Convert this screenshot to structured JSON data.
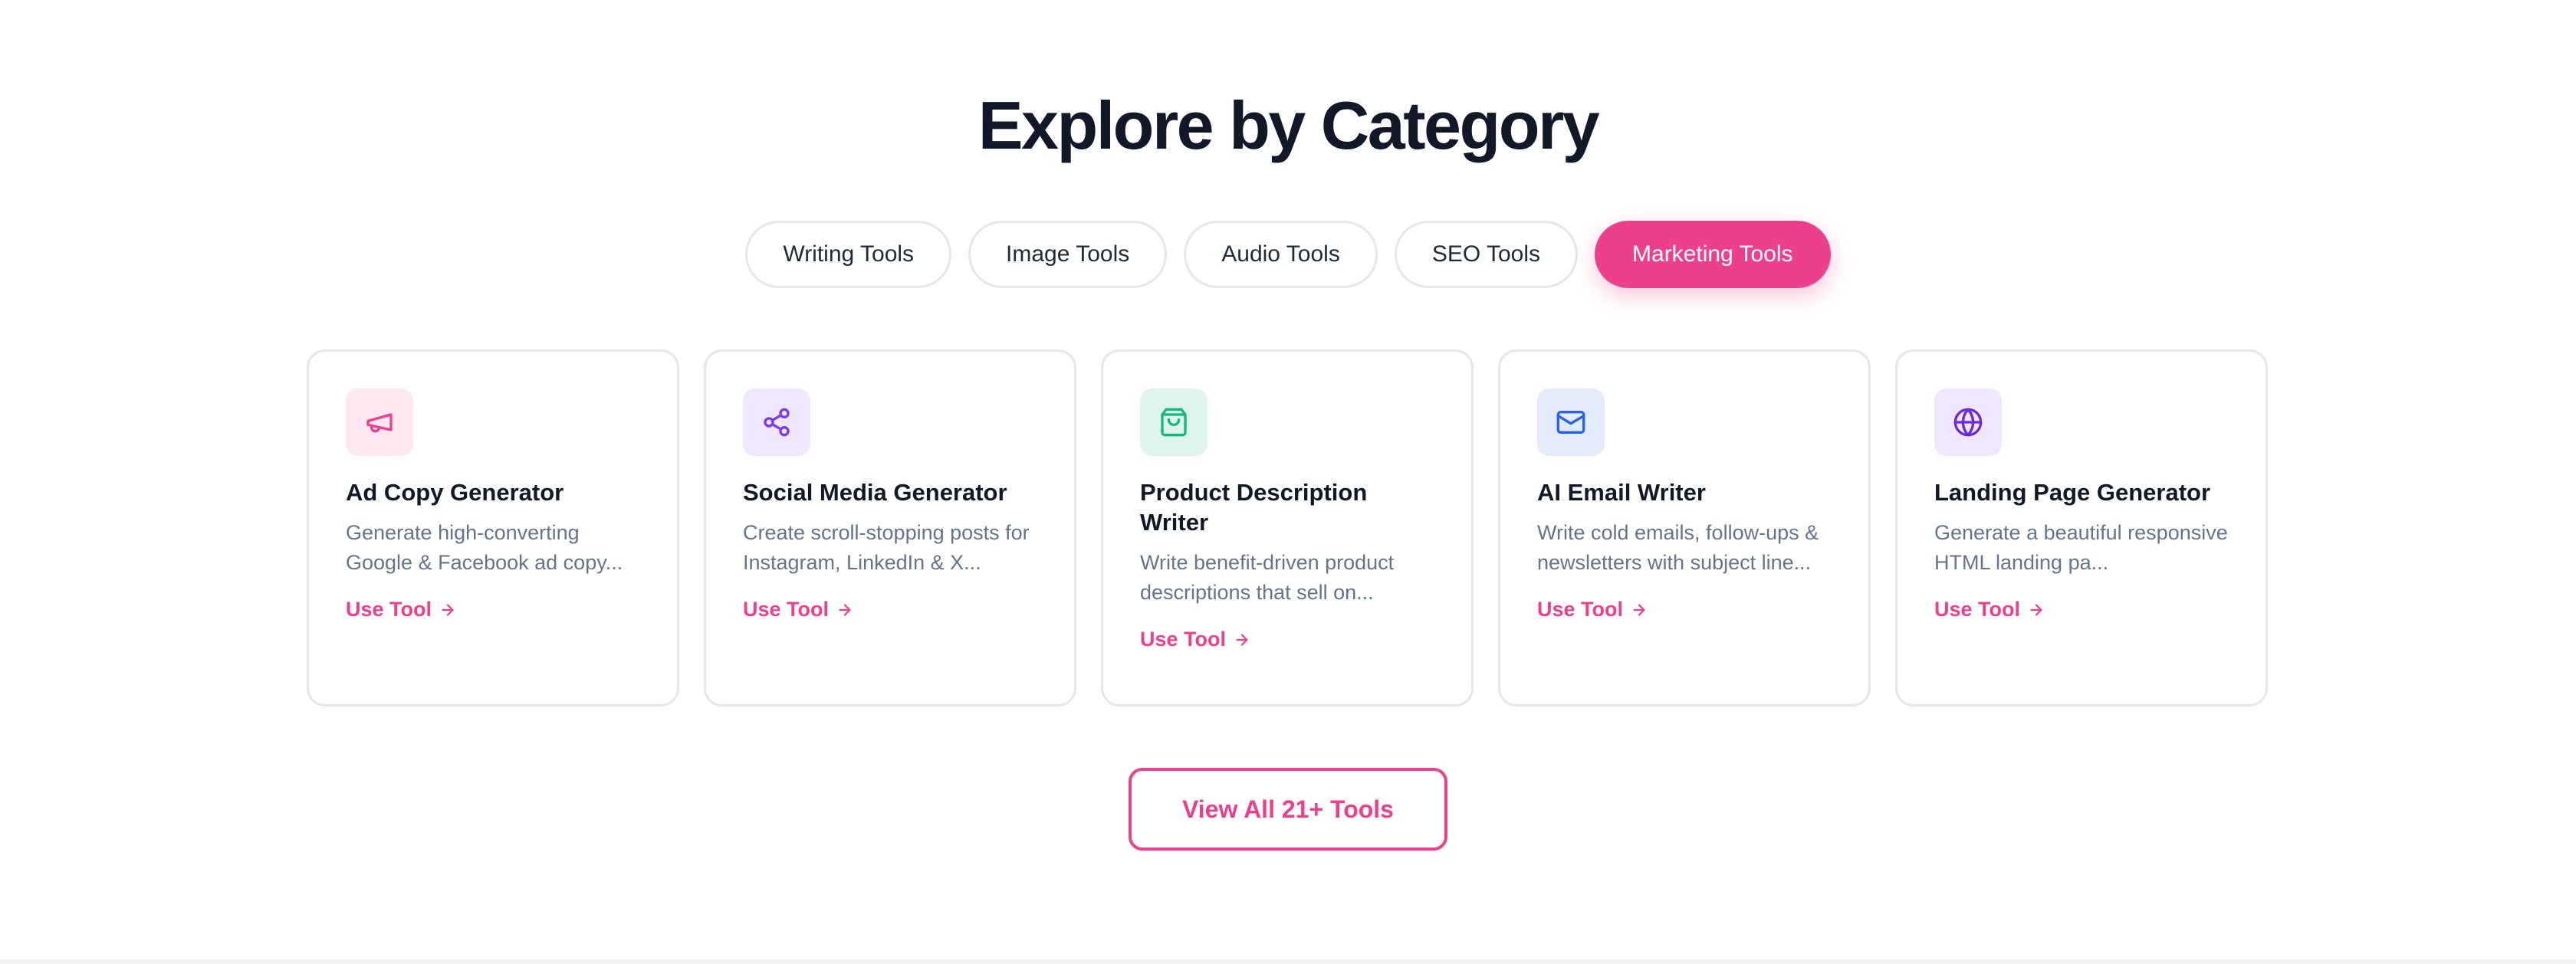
{
  "section": {
    "title": "Explore by Category"
  },
  "tabs": [
    {
      "label": "Writing Tools",
      "active": false
    },
    {
      "label": "Image Tools",
      "active": false
    },
    {
      "label": "Audio Tools",
      "active": false
    },
    {
      "label": "SEO Tools",
      "active": false
    },
    {
      "label": "Marketing Tools",
      "active": true
    }
  ],
  "cards": [
    {
      "icon": "megaphone-icon",
      "icon_color": "#ec3f8c",
      "icon_bg": "#fde7f1",
      "title": "Ad Copy Generator",
      "description": "Generate high-converting Google & Facebook ad copy...",
      "link_label": "Use Tool"
    },
    {
      "icon": "share-icon",
      "icon_color": "#7c3aed",
      "icon_bg": "#efe7fd",
      "title": "Social Media Generator",
      "description": "Create scroll-stopping posts for Instagram, LinkedIn & X...",
      "link_label": "Use Tool"
    },
    {
      "icon": "shopping-bag-icon",
      "icon_color": "#10b981",
      "icon_bg": "#dff5ec",
      "title": "Product Description Writer",
      "description": "Write benefit-driven product descriptions that sell on...",
      "link_label": "Use Tool"
    },
    {
      "icon": "mail-icon",
      "icon_color": "#2563eb",
      "icon_bg": "#e3ebfb",
      "title": "AI Email Writer",
      "description": "Write cold emails, follow-ups & newsletters with subject line...",
      "link_label": "Use Tool"
    },
    {
      "icon": "globe-icon",
      "icon_color": "#6d28d9",
      "icon_bg": "#efe7fd",
      "title": "Landing Page Generator",
      "description": "Generate a beautiful responsive HTML landing pa...",
      "link_label": "Use Tool"
    }
  ],
  "view_all": {
    "label": "View All 21+ Tools"
  },
  "colors": {
    "accent": "#ec3f8c",
    "heading": "#111827",
    "body_text": "#64748b",
    "border": "#e5e7eb"
  }
}
